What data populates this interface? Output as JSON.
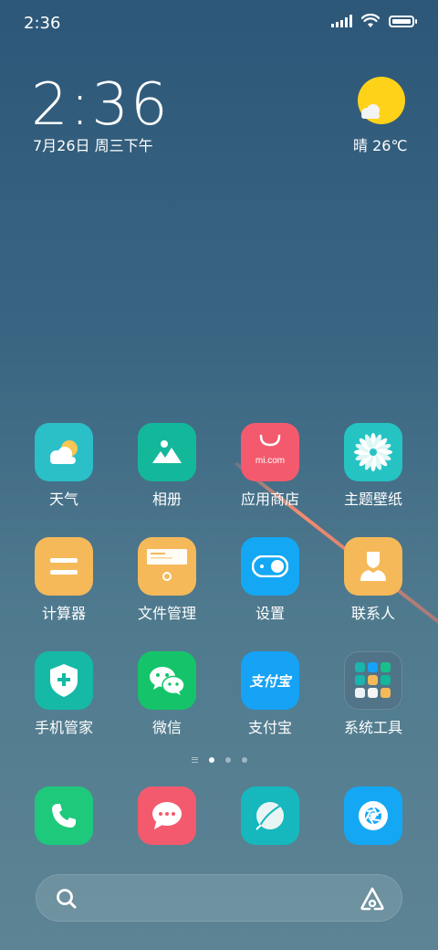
{
  "status_bar": {
    "time": "2:36",
    "battery_level": 1.0,
    "signal_bars": 5
  },
  "clock_widget": {
    "time": "2:36",
    "date": "7月26日 周三下午"
  },
  "weather_widget": {
    "icon": "sunny-cloud-icon",
    "text": "晴 26℃"
  },
  "apps": [
    {
      "label": "天气",
      "icon": "weather-icon",
      "color": "#2bbfc8"
    },
    {
      "label": "相册",
      "icon": "gallery-icon",
      "color": "#13b89a"
    },
    {
      "label": "应用商店",
      "icon": "app-store-icon",
      "color": "#f35a6e",
      "brand_text": "mi.com"
    },
    {
      "label": "主题壁纸",
      "icon": "themes-icon",
      "color": "#26c3c3"
    },
    {
      "label": "计算器",
      "icon": "calculator-icon",
      "color": "#f5b95a"
    },
    {
      "label": "文件管理",
      "icon": "file-manager-icon",
      "color": "#f5b95a"
    },
    {
      "label": "设置",
      "icon": "settings-icon",
      "color": "#14a8f4"
    },
    {
      "label": "联系人",
      "icon": "contacts-icon",
      "color": "#f5b95a"
    },
    {
      "label": "手机管家",
      "icon": "security-icon",
      "color": "#16b9a6"
    },
    {
      "label": "微信",
      "icon": "wechat-icon",
      "color": "#15c46a"
    },
    {
      "label": "支付宝",
      "icon": "alipay-icon",
      "color": "#16a2f5",
      "brand_text": "支付宝"
    },
    {
      "label": "系统工具",
      "icon": "folder-icon",
      "color": "#4d6d82"
    }
  ],
  "page_indicator": {
    "pages": 3,
    "current": 1
  },
  "dock": [
    {
      "icon": "phone-icon",
      "color": "#1ec97c"
    },
    {
      "icon": "messages-icon",
      "color": "#f35a6e"
    },
    {
      "icon": "browser-icon",
      "color": "#16b8be"
    },
    {
      "icon": "camera-icon",
      "color": "#14a8f4"
    }
  ],
  "search_bar": {
    "search_icon": "search-icon",
    "assistant_icon": "assistant-icon"
  }
}
